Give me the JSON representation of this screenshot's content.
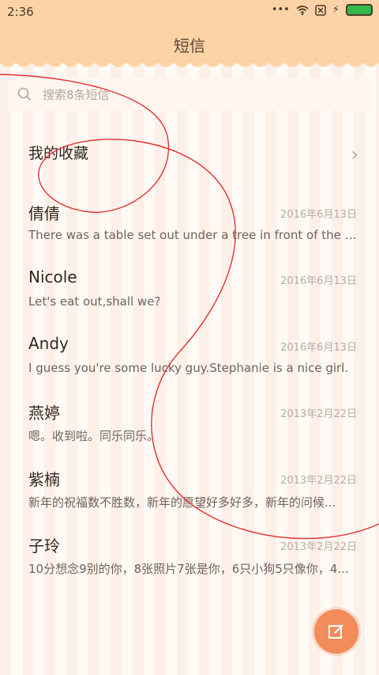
{
  "status_bar": {
    "time": "2:36"
  },
  "header": {
    "title": "短信"
  },
  "search": {
    "placeholder": "搜索8条短信"
  },
  "favorites": {
    "label": "我的收藏"
  },
  "messages": [
    {
      "name": "倩倩",
      "date": "2016年6月13日",
      "preview": "There was a table set out under a tree in front of the ho..."
    },
    {
      "name": "Nicole",
      "date": "2016年6月13日",
      "preview": "Let's eat out,shall we?"
    },
    {
      "name": "Andy",
      "date": "2016年6月13日",
      "preview": "I guess you're some lucky guy.Stephanie is a nice girl."
    },
    {
      "name": "燕婷",
      "date": "2013年2月22日",
      "preview": "嗯。收到啦。同乐同乐。"
    },
    {
      "name": "紫楠",
      "date": "2013年2月22日",
      "preview": "新年的祝福数不胜数，新年的愿望好多好多，新年的问候..."
    },
    {
      "name": "子玲",
      "date": "2013年2月22日",
      "preview": "10分想念9别的你，8张照片7张是你，6只小狗5只像你，4..."
    }
  ],
  "colors": {
    "accent": "#f28c5a",
    "header": "#fcd3a6"
  },
  "icons": {
    "compose": "compose-icon",
    "search": "search-icon"
  }
}
